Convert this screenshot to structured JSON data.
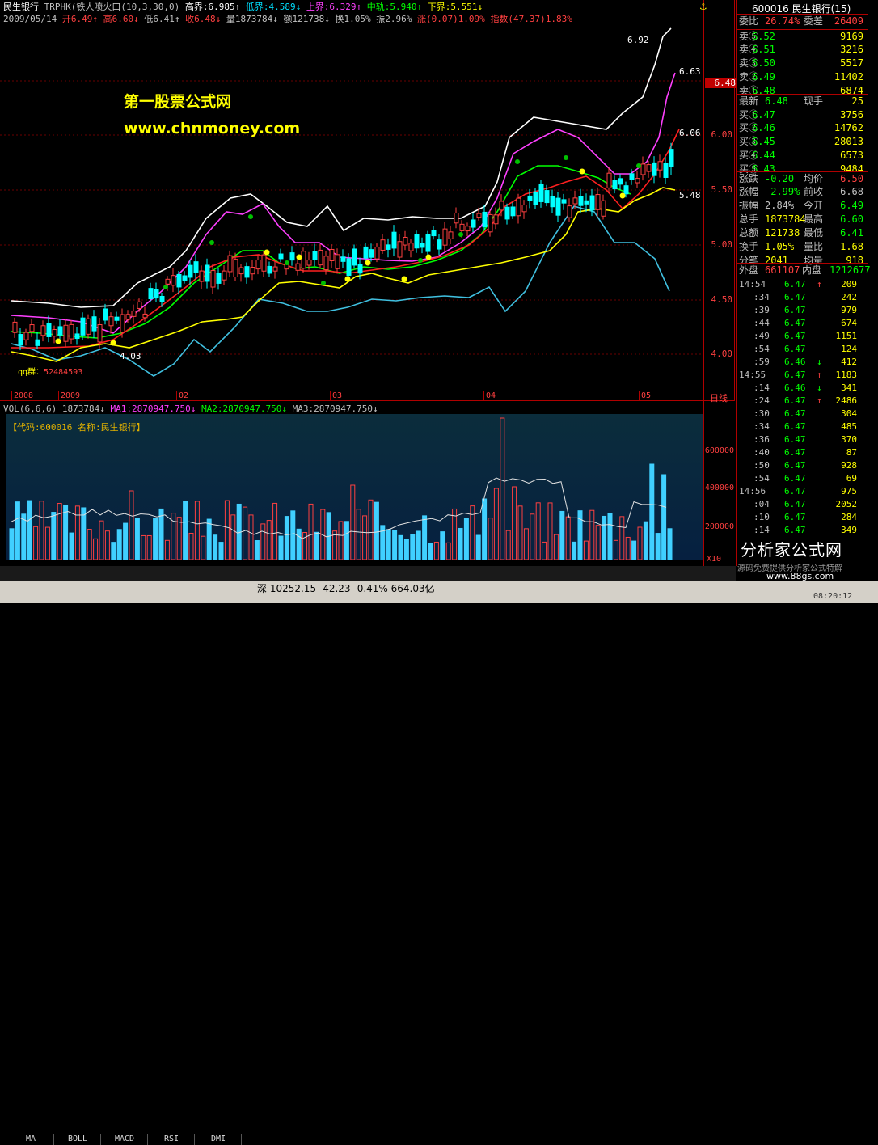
{
  "header": {
    "stock_name": "民生银行",
    "indicator": "TRPHK(铁人喷火口(10,3,30,0)",
    "items": [
      {
        "label": "高界:",
        "value": "6.985",
        "arrow": "↑",
        "color": "#ffffff"
      },
      {
        "label": "低界:",
        "value": "4.589",
        "arrow": "↓",
        "color": "#00e0ff"
      },
      {
        "label": "上界:",
        "value": "6.329",
        "arrow": "↑",
        "color": "#ff40ff"
      },
      {
        "label": "中轨:",
        "value": "5.940",
        "arrow": "↑",
        "color": "#00ff00"
      },
      {
        "label": "下界:",
        "value": "5.551",
        "arrow": "↓",
        "color": "#ffff00"
      }
    ],
    "line2": [
      {
        "text": "2009/05/14",
        "color": "#c0c0c0"
      },
      {
        "text": "开6.49↑",
        "color": "#ff4040"
      },
      {
        "text": "高6.60↓",
        "color": "#ff4040"
      },
      {
        "text": "低6.41↑",
        "color": "#c0c0c0"
      },
      {
        "text": "收6.48↓",
        "color": "#ff4040"
      },
      {
        "text": "量1873784↓",
        "color": "#c0c0c0"
      },
      {
        "text": "额121738↓",
        "color": "#c0c0c0"
      },
      {
        "text": "换1.05%",
        "color": "#c0c0c0"
      },
      {
        "text": "振2.96%",
        "color": "#c0c0c0"
      },
      {
        "text": "涨(0.07)1.09%",
        "color": "#ff4040"
      },
      {
        "text": "指数(47.37)1.83%",
        "color": "#ff4040"
      }
    ]
  },
  "watermark": {
    "line1": "第一股票公式网",
    "line2": "www.chnmoney.com"
  },
  "price_axis": [
    "6.00",
    "5.50",
    "5.00",
    "4.50",
    "4.00"
  ],
  "current_price_tag": "6.48",
  "annotations": {
    "high_label": "6.92",
    "upper_label": "6.63",
    "mid_label": "6.06",
    "lower_label": "5.48",
    "low_label": "4.03",
    "qq_label": "qq群：",
    "qq_value": "52484593"
  },
  "date_axis": [
    "2008",
    "2009",
    "02",
    "03",
    "04",
    "05"
  ],
  "period_label": "日线",
  "volume": {
    "header": "VOL(6,6,6)",
    "vol_value": "1873784↓",
    "ma1": "MA1:2870947.750↓",
    "ma2": "MA2:2870947.750↓",
    "ma3": "MA3:2870947.750↓",
    "info": "【代码:600016 名称:民生银行】",
    "axis": [
      "600000",
      "400000",
      "200000"
    ],
    "unit": "X10"
  },
  "tabs": [
    "MA",
    "BOLL",
    "MACD",
    "RSI",
    "DMI"
  ],
  "status_bar": {
    "text": "深 10252.15 -42.23 -0.41% 664.03亿",
    "time": "08:20:12"
  },
  "side_panel": {
    "title": "600016 民生银行(15)",
    "weibi": {
      "label": "委比",
      "value": "26.74%",
      "label2": "委差",
      "value2": "26409"
    },
    "asks": [
      {
        "label": "卖⑤",
        "price": "6.52",
        "vol": "9169"
      },
      {
        "label": "卖④",
        "price": "6.51",
        "vol": "3216"
      },
      {
        "label": "卖③",
        "price": "6.50",
        "vol": "5517"
      },
      {
        "label": "卖②",
        "price": "6.49",
        "vol": "11402"
      },
      {
        "label": "卖①",
        "price": "6.48",
        "vol": "6874"
      }
    ],
    "latest": {
      "label": "最新",
      "value": "6.48",
      "label2": "现手",
      "value2": "25"
    },
    "bids": [
      {
        "label": "买①",
        "price": "6.47",
        "vol": "3756"
      },
      {
        "label": "买②",
        "price": "6.46",
        "vol": "14762"
      },
      {
        "label": "买③",
        "price": "6.45",
        "vol": "28013"
      },
      {
        "label": "买④",
        "price": "6.44",
        "vol": "6573"
      },
      {
        "label": "买⑤",
        "price": "6.43",
        "vol": "9484"
      }
    ],
    "stats": [
      {
        "l1": "涨跌",
        "v1": "-0.20",
        "c1": "#00ff00",
        "l2": "均价",
        "v2": "6.50",
        "c2": "#ff4040"
      },
      {
        "l1": "涨幅",
        "v1": "-2.99%",
        "c1": "#00ff00",
        "l2": "前收",
        "v2": "6.68",
        "c2": "#c0c0c0"
      },
      {
        "l1": "振幅",
        "v1": "2.84%",
        "c1": "#c0c0c0",
        "l2": "今开",
        "v2": "6.49",
        "c2": "#00ff00"
      },
      {
        "l1": "总手",
        "v1": "1873784",
        "c1": "#ffff00",
        "l2": "最高",
        "v2": "6.60",
        "c2": "#00ff00"
      },
      {
        "l1": "总额",
        "v1": "121738",
        "c1": "#ffff00",
        "l2": "最低",
        "v2": "6.41",
        "c2": "#00ff00"
      },
      {
        "l1": "换手",
        "v1": "1.05%",
        "c1": "#ffff00",
        "l2": "量比",
        "v2": "1.68",
        "c2": "#ffff00"
      },
      {
        "l1": "分笔",
        "v1": "2041",
        "c1": "#ffff00",
        "l2": "均量",
        "v2": "918",
        "c2": "#ffff00"
      }
    ],
    "outer": {
      "label": "外盘",
      "value": "661107",
      "label2": "内盘",
      "value2": "1212677"
    },
    "ticks": [
      {
        "time": "14:54",
        "price": "6.47",
        "arrow": "↑",
        "vol": "209"
      },
      {
        "time": ":34",
        "price": "6.47",
        "arrow": "",
        "vol": "242"
      },
      {
        "time": ":39",
        "price": "6.47",
        "arrow": "",
        "vol": "979"
      },
      {
        "time": ":44",
        "price": "6.47",
        "arrow": "",
        "vol": "674"
      },
      {
        "time": ":49",
        "price": "6.47",
        "arrow": "",
        "vol": "1151"
      },
      {
        "time": ":54",
        "price": "6.47",
        "arrow": "",
        "vol": "124"
      },
      {
        "time": ":59",
        "price": "6.46",
        "arrow": "↓",
        "vol": "412"
      },
      {
        "time": "14:55",
        "price": "6.47",
        "arrow": "↑",
        "vol": "1183"
      },
      {
        "time": ":14",
        "price": "6.46",
        "arrow": "↓",
        "vol": "341"
      },
      {
        "time": ":24",
        "price": "6.47",
        "arrow": "↑",
        "vol": "2486"
      },
      {
        "time": ":30",
        "price": "6.47",
        "arrow": "",
        "vol": "304"
      },
      {
        "time": ":34",
        "price": "6.47",
        "arrow": "",
        "vol": "485"
      },
      {
        "time": ":36",
        "price": "6.47",
        "arrow": "",
        "vol": "370"
      },
      {
        "time": ":40",
        "price": "6.47",
        "arrow": "",
        "vol": "87"
      },
      {
        "time": ":50",
        "price": "6.47",
        "arrow": "",
        "vol": "928"
      },
      {
        "time": ":54",
        "price": "6.47",
        "arrow": "",
        "vol": "69"
      },
      {
        "time": "14:56",
        "price": "6.47",
        "arrow": "",
        "vol": "975"
      },
      {
        "time": ":04",
        "price": "6.47",
        "arrow": "",
        "vol": "2052"
      },
      {
        "time": ":10",
        "price": "6.47",
        "arrow": "",
        "vol": "284"
      },
      {
        "time": ":14",
        "price": "6.47",
        "arrow": "",
        "vol": "349"
      }
    ],
    "badge": "分析家公式网",
    "badge_sub": "www.88gs.com",
    "badge_sub2": "源码免费提供分析家公式特解"
  }
}
